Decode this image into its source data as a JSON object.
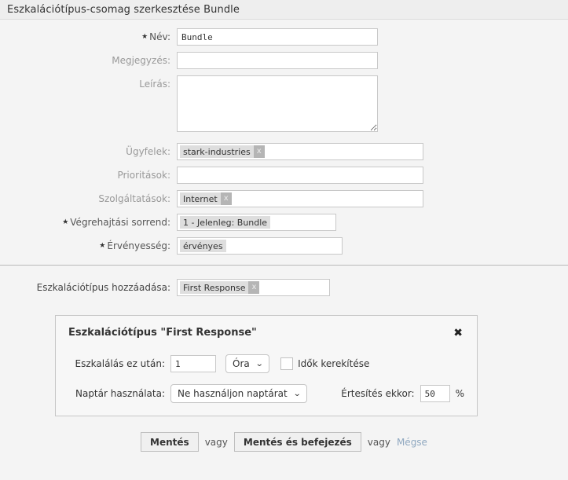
{
  "window": {
    "title": "Eszkalációtípus-csomag szerkesztése Bundle"
  },
  "form": {
    "fields": [
      {
        "label": "Név:",
        "required": true,
        "value": "Bundle"
      },
      {
        "label": "Megjegyzés:",
        "required": false,
        "value": ""
      },
      {
        "label": "Leírás:",
        "required": false,
        "value": ""
      },
      {
        "label": "Ügyfelek:",
        "required": false,
        "chips": [
          "stark-industries"
        ]
      },
      {
        "label": "Prioritások:",
        "required": false,
        "chips": []
      },
      {
        "label": "Szolgáltatások:",
        "required": false,
        "chips": [
          "Internet"
        ]
      },
      {
        "label": "Végrehajtási sorrend:",
        "required": true,
        "chips": [
          "1 - Jelenleg: Bundle"
        ]
      },
      {
        "label": "Érvényesség:",
        "required": true,
        "chips": [
          "érvényes"
        ]
      }
    ],
    "name_label": "Név:",
    "name_value": "Bundle",
    "comment_label": "Megjegyzés:",
    "comment_value": "",
    "description_label": "Leírás:",
    "description_value": "",
    "customers_label": "Ügyfelek:",
    "customers_chip": "stark-industries",
    "priorities_label": "Prioritások:",
    "services_label": "Szolgáltatások:",
    "services_chip": "Internet",
    "order_label": "Végrehajtási sorrend:",
    "order_chip": "1 - Jelenleg: Bundle",
    "validity_label": "Érvényesség:",
    "validity_chip": "érvényes",
    "chip_close_label": "x"
  },
  "add_escalation": {
    "label": "Eszkalációtípus hozzáadása:",
    "chip": "First Response",
    "chip_close_label": "x"
  },
  "escalation_panel": {
    "title": "Eszkalációtípus \"First Response\"",
    "close_label": "✖",
    "escalate_after_label": "Eszkalálás ez után:",
    "escalate_after_value": "1",
    "unit_value": "Óra",
    "unit_chevron": "⌄",
    "round_times_label": "Idők kerekítése",
    "round_times_checked": false,
    "calendar_label": "Naptár használata:",
    "calendar_value": "Ne használjon naptárat",
    "calendar_chevron": "⌄",
    "notify_label": "Értesítés ekkor:",
    "notify_value": "50",
    "notify_unit": "%"
  },
  "footer": {
    "save_label": "Mentés",
    "or_label_1": "vagy",
    "save_finish_label": "Mentés és befejezés",
    "or_label_2": "vagy",
    "cancel_label": "Mégse"
  },
  "colors": {
    "page_bg": "#f4f4f4",
    "titlebar_bg": "#eeeeee",
    "panel_bg": "#f7f7f7",
    "chip_bg": "#dedede",
    "chip_x_bg": "#b5b5b5",
    "cancel_link": "#8fa8c0",
    "label_muted": "#999999"
  }
}
